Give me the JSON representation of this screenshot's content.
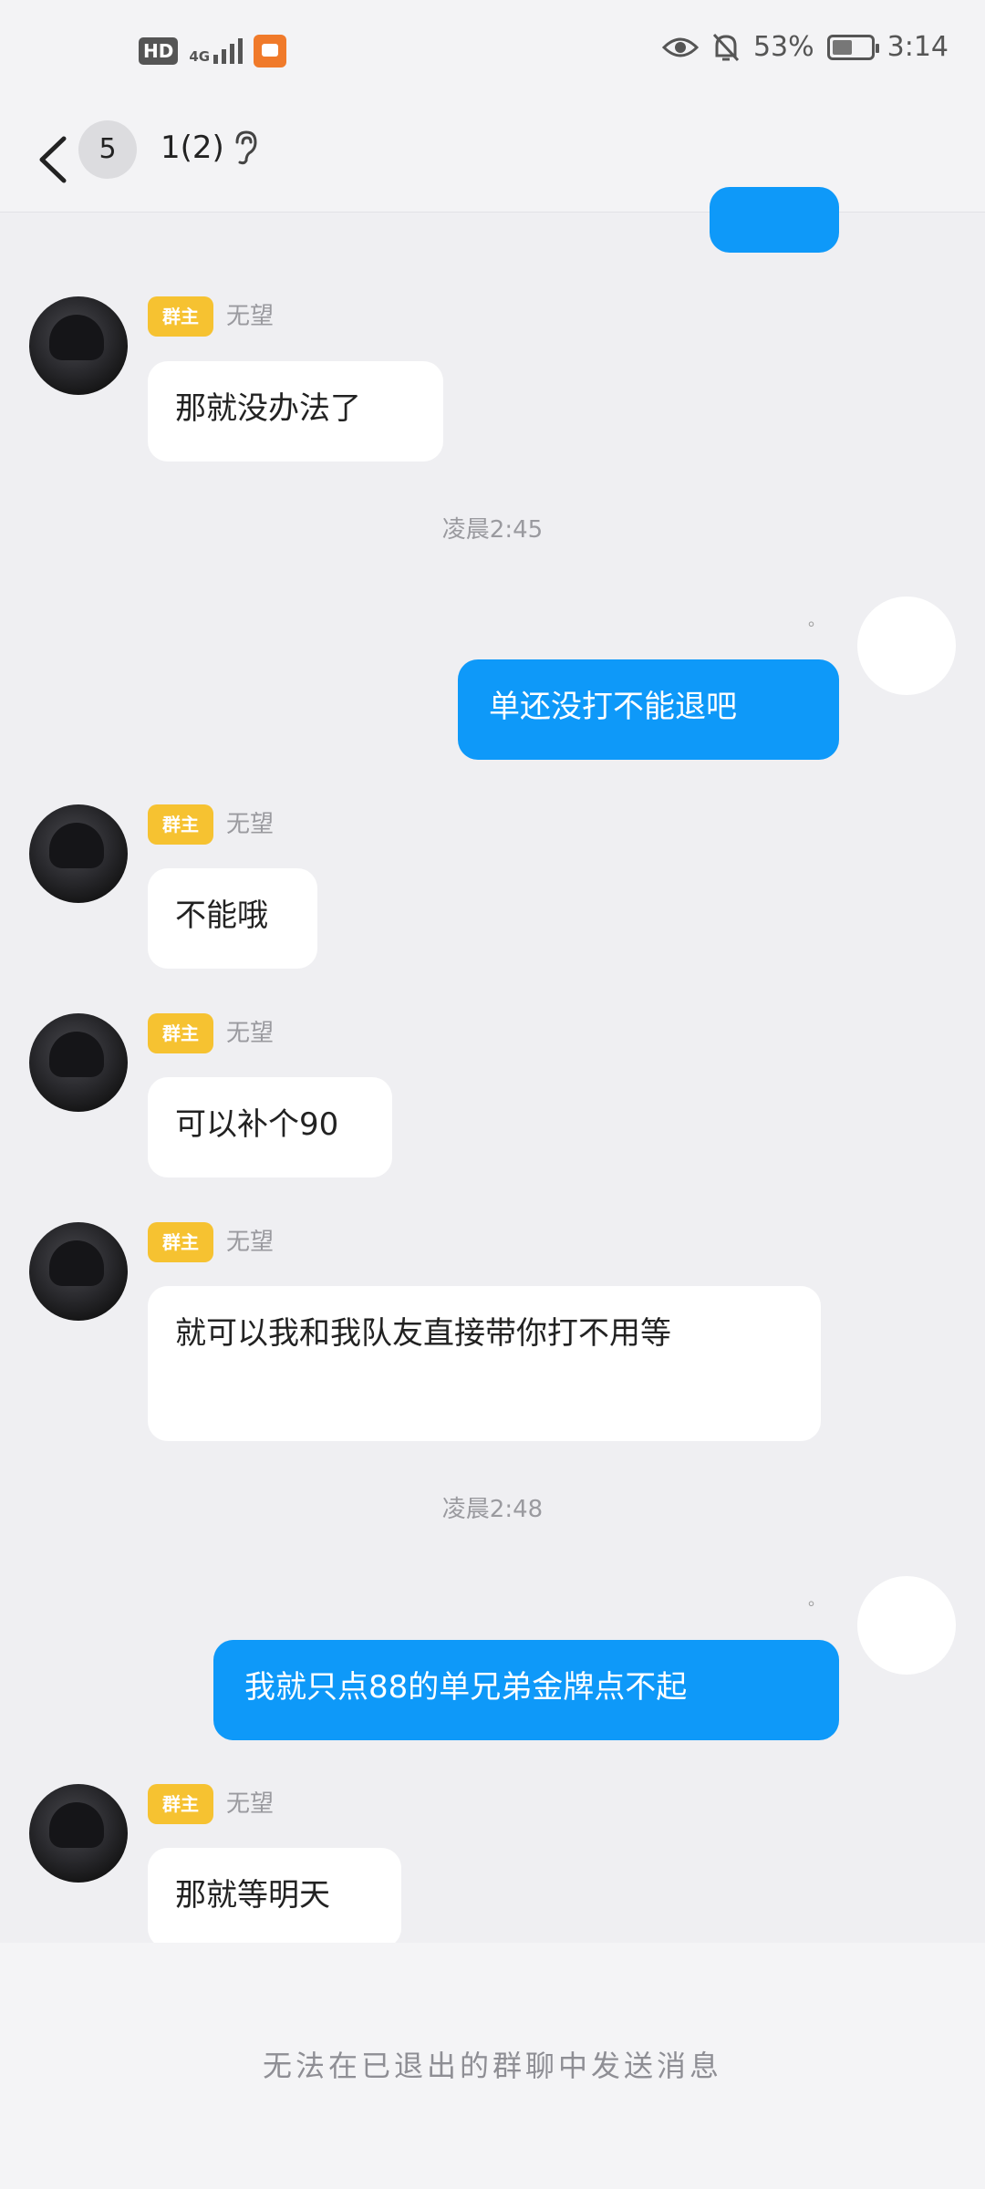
{
  "status_bar": {
    "hd_label": "HD",
    "network_label": "4G",
    "battery_percent": "53%",
    "battery_level": 0.53,
    "time": "3:14"
  },
  "header": {
    "unread_count": "5",
    "title": "1(2)",
    "icons": [
      "back-arrow-icon",
      "ear-icon"
    ]
  },
  "messages": {
    "m1": {
      "tag": "群主",
      "sender": "无望",
      "text": "那就没办法了"
    },
    "t1": "凌晨2:45",
    "m2": {
      "text": "单还没打不能退吧"
    },
    "m3": {
      "tag": "群主",
      "sender": "无望",
      "text": "不能哦"
    },
    "m4": {
      "tag": "群主",
      "sender": "无望",
      "text": "可以补个90"
    },
    "m5": {
      "tag": "群主",
      "sender": "无望",
      "text": "就可以我和我队友直接带你打不用等"
    },
    "t2": "凌晨2:48",
    "m6": {
      "text": "我就只点88的单兄弟金牌点不起"
    },
    "m7": {
      "tag": "群主",
      "sender": "无望",
      "text": "那就等明天"
    }
  },
  "footer": {
    "notice": "无法在已退出的群聊中发送消息"
  }
}
